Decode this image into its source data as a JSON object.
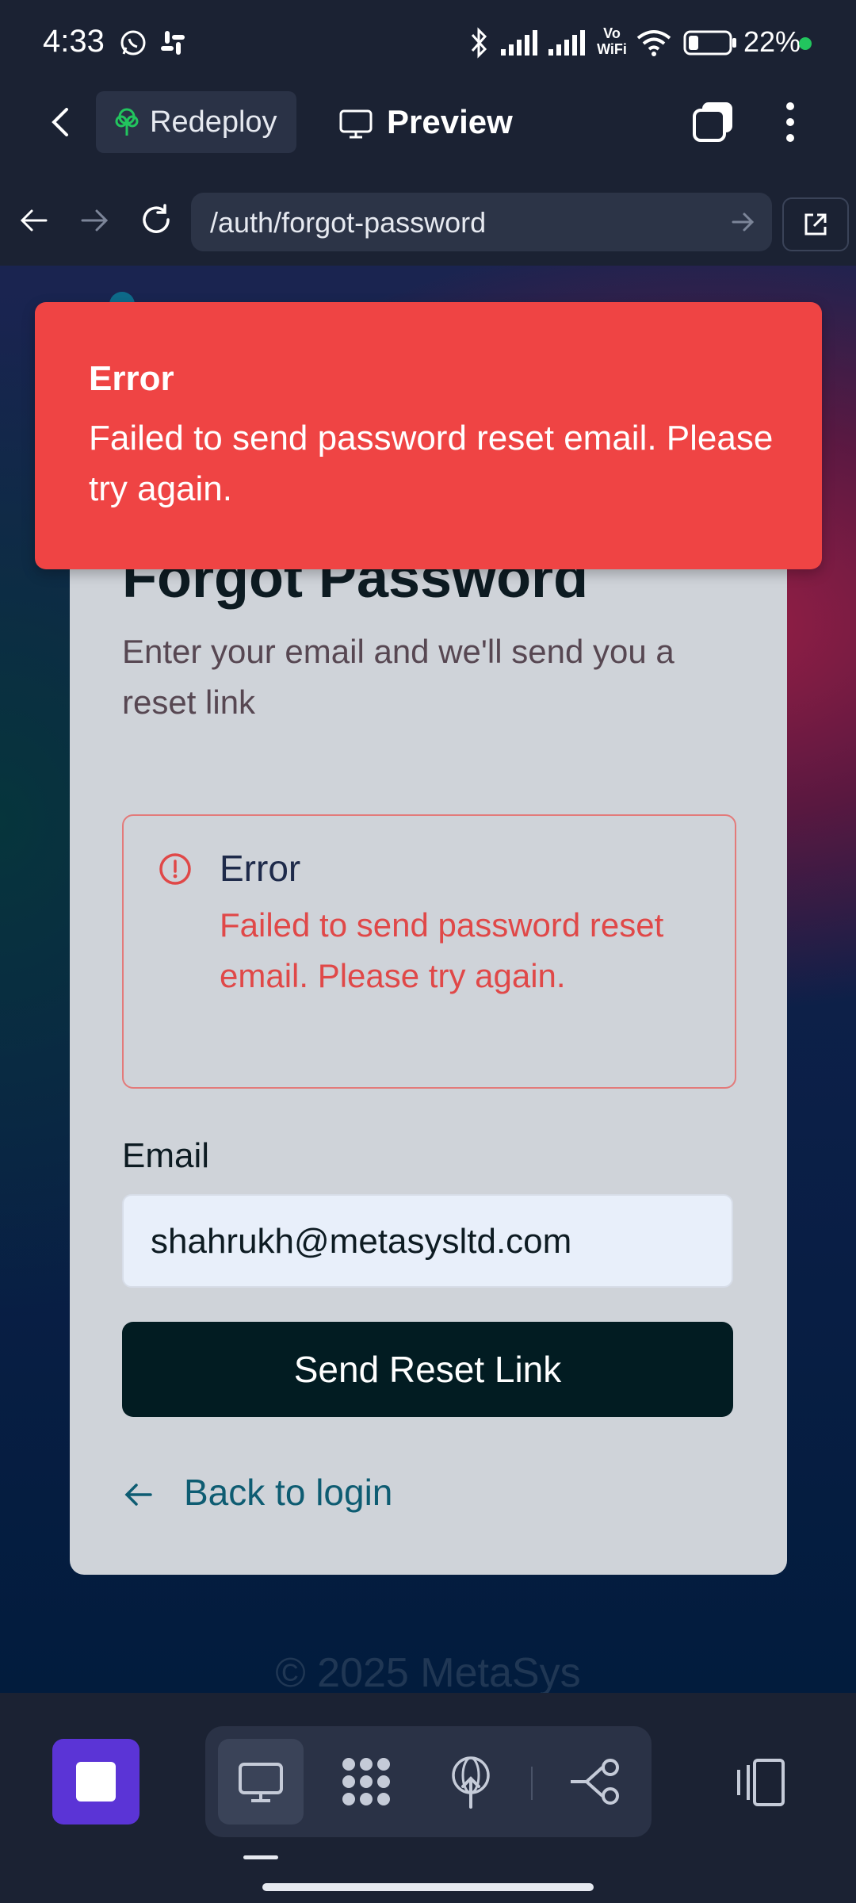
{
  "status_bar": {
    "time": "4:33",
    "battery_text": "22%",
    "icons": [
      "whatsapp-icon",
      "slack-icon",
      "bluetooth-icon",
      "signal-icon",
      "signal-icon",
      "vowifi-icon",
      "wifi-icon",
      "battery-icon"
    ]
  },
  "toolbar": {
    "redeploy_label": "Redeploy",
    "preview_label": "Preview"
  },
  "url_bar": {
    "url": "/auth/forgot-password"
  },
  "toast": {
    "title": "Error",
    "message": "Failed to send password reset email. Please try again.",
    "background": "#ef4444"
  },
  "card": {
    "title": "Forgot Password",
    "subtitle": "Enter your email and we'll send you a reset link",
    "alert": {
      "title": "Error",
      "message": "Failed to send password reset email. Please try again."
    },
    "email_label": "Email",
    "email_value": "shahrukh@metasysltd.com",
    "submit_label": "Send Reset Link",
    "back_label": "Back to login"
  },
  "footer": {
    "text": "© 2025 MetaSys"
  },
  "dock": {
    "items": [
      "stop-icon",
      "desktop-icon",
      "apps-grid-icon",
      "deploy-icon",
      "branch-icon",
      "device-frame-icon"
    ],
    "accent": "#5b34d6"
  }
}
